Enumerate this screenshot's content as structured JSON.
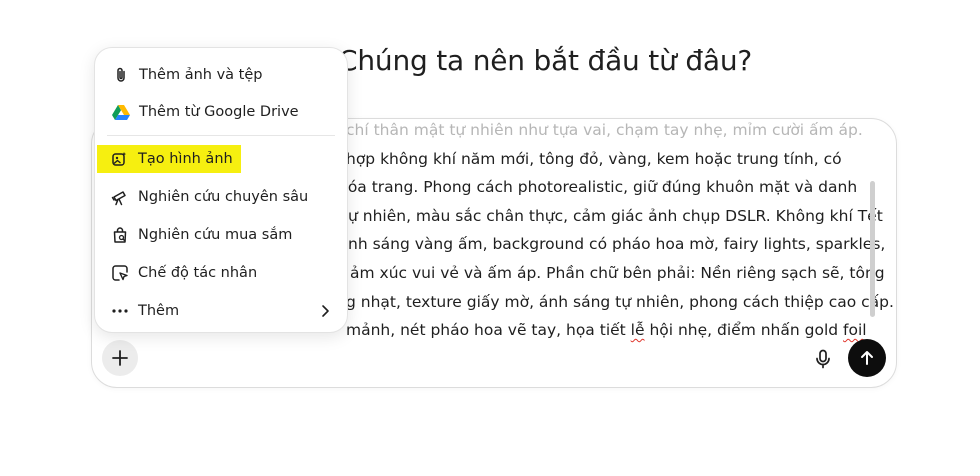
{
  "heading": "Chúng ta nên bắt đầu từ đâu?",
  "prompt_lines": [
    "chí thân mật tự nhiên như tựa vai, chạm tay nhẹ, mỉm cười ấm áp.",
    "hợp không khí năm mới, tông đỏ, vàng, kem hoặc trung tính, có",
    "hóa trang. Phong cách photorealistic, giữ đúng khuôn mặt và danh",
    "ự nhiên, màu sắc chân thực, cảm giác ảnh chụp DSLR. Không khí Tết",
    "nh sáng vàng ấm, background có pháo hoa mờ, fairy lights, sparkles,",
    "ảm xúc vui vẻ và ấm áp. Phần chữ bên phải: Nền riêng sạch sẽ, tông",
    "g nhạt, texture giấy mờ, ánh sáng tự nhiên, phong cách thiệp cao cấp.",
    "mảnh, nét pháo hoa vẽ tay, họa tiết lễ hội nhẹ, điểm nhấn gold foil"
  ],
  "menu": {
    "items": [
      {
        "label": "Thêm ảnh và tệp",
        "icon": "paperclip-icon"
      },
      {
        "label": "Thêm từ Google Drive",
        "icon": "google-drive-icon"
      },
      {
        "label": "Tạo hình ảnh",
        "icon": "image-create-icon"
      },
      {
        "label": "Nghiên cứu chuyên sâu",
        "icon": "telescope-icon"
      },
      {
        "label": "Nghiên cứu mua sắm",
        "icon": "shopping-bag-icon"
      },
      {
        "label": "Chế độ tác nhân",
        "icon": "cursor-agent-icon"
      },
      {
        "label": "Thêm",
        "icon": "more-dots-icon"
      }
    ]
  },
  "colors": {
    "highlight": "#f6ef10",
    "send_button": "#0d0d0d",
    "spellcheck": "#e0342a"
  }
}
